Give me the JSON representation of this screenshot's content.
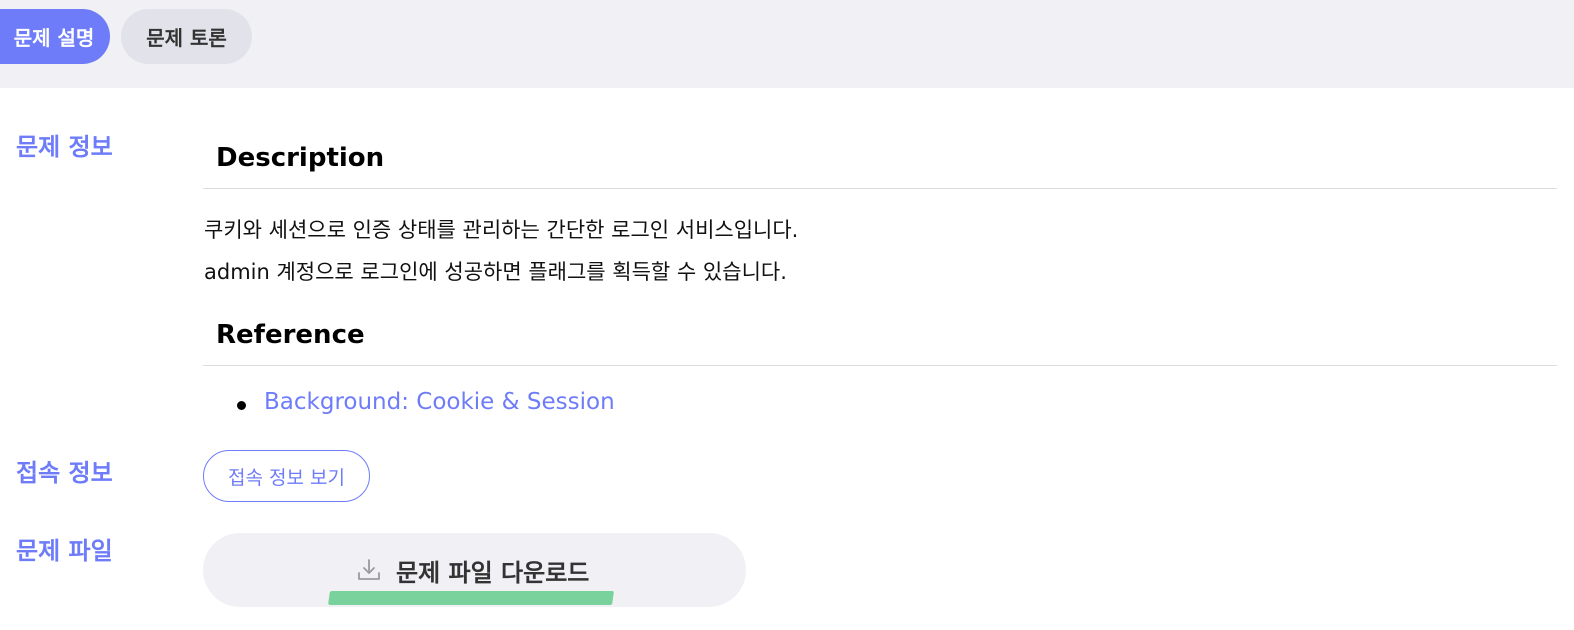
{
  "tabs": {
    "active_label": "문제 설명",
    "inactive_label": "문제 토론"
  },
  "problem_info": {
    "label": "문제 정보",
    "description_heading": "Description",
    "description_lines": [
      "쿠키와 세션으로 인증 상태를 관리하는 간단한 로그인 서비스입니다.",
      "admin 계정으로 로그인에 성공하면 플래그를 획득할 수 있습니다."
    ],
    "reference_heading": "Reference",
    "reference_link": "Background: Cookie & Session"
  },
  "connection_info": {
    "label": "접속 정보",
    "button_label": "접속 정보 보기"
  },
  "problem_file": {
    "label": "문제 파일",
    "download_label": "문제 파일 다운로드",
    "icon": "download-icon"
  },
  "colors": {
    "accent": "#6e7cf9",
    "highlight": "#79d29c",
    "topbar_bg": "#f0f0f5"
  }
}
